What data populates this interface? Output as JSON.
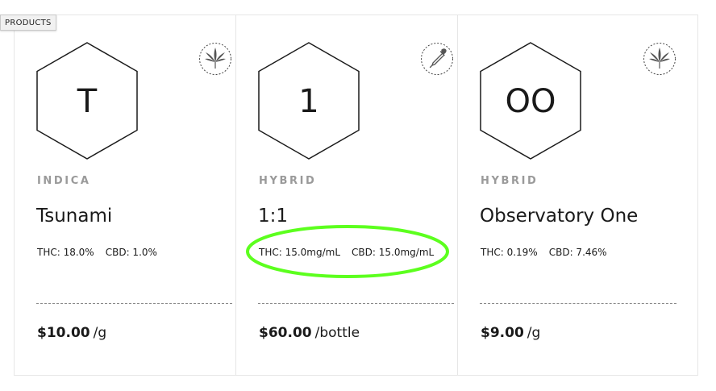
{
  "products_label": "PRODUCTS",
  "colors": {
    "highlight": "#5cff1e",
    "strain_label": "#9a9a9a",
    "border": "#e6e6e6"
  },
  "cards": [
    {
      "letter": "T",
      "badge_icon": "leaf-icon",
      "strain": "INDICA",
      "name": "Tsunami",
      "thc": "THC: 18.0%",
      "cbd": "CBD: 1.0%",
      "price": "$10.00",
      "unit": "/g"
    },
    {
      "letter": "1",
      "badge_icon": "dropper-icon",
      "strain": "HYBRID",
      "name": "1:1",
      "thc": "THC: 15.0mg/mL",
      "cbd": "CBD: 15.0mg/mL",
      "price": "$60.00",
      "unit": "/bottle"
    },
    {
      "letter": "OO",
      "badge_icon": "leaf-icon",
      "strain": "HYBRID",
      "name": "Observatory One",
      "thc": "THC: 0.19%",
      "cbd": "CBD: 7.46%",
      "price": "$9.00",
      "unit": "/g"
    }
  ]
}
